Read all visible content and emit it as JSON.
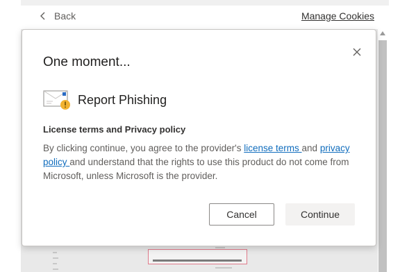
{
  "nav": {
    "back_label": "Back",
    "manage_cookies_label": "Manage Cookies"
  },
  "dialog": {
    "title": "One moment...",
    "addin_name": "Report Phishing",
    "license_heading": "License terms and Privacy policy",
    "license_text_1": "By clicking continue, you agree to the provider's ",
    "license_terms_link": "license terms ",
    "license_text_2": "and ",
    "privacy_policy_link": "privacy policy ",
    "license_text_3": "and understand that the rights to use this product do not come from Microsoft, unless Microsoft is the provider.",
    "cancel_label": "Cancel",
    "continue_label": "Continue"
  },
  "colors": {
    "link": "#0f6cbd",
    "icon_warning": "#f2b230",
    "icon_accent": "#2b6cc4"
  },
  "icons": [
    "chevron-left-icon",
    "close-icon",
    "report-phishing-icon",
    "scroll-up-arrow-icon"
  ]
}
